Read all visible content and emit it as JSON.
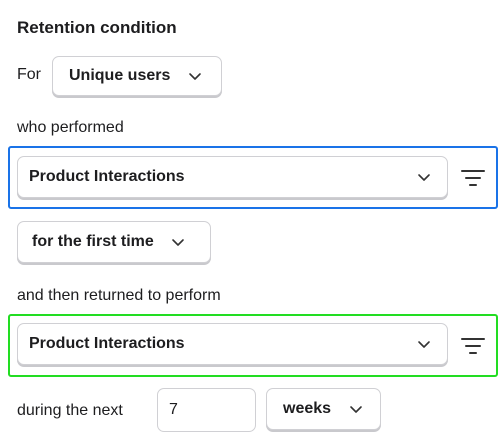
{
  "heading": "Retention condition",
  "for_label": "For",
  "user_type": {
    "selected": "Unique users",
    "icon": "chevron-down-icon"
  },
  "who_performed_label": "who performed",
  "first_event": {
    "selected": "Product Interactions",
    "icon": "chevron-down-icon",
    "filter_icon": "filter-icon",
    "highlight_color": "#1a73e8"
  },
  "occurrence": {
    "selected": "for the first time",
    "icon": "chevron-down-icon"
  },
  "returned_label": "and then returned to perform",
  "return_event": {
    "selected": "Product Interactions",
    "icon": "chevron-down-icon",
    "filter_icon": "filter-icon",
    "highlight_color": "#22dd22"
  },
  "during_label": "during the next",
  "period": {
    "value": "7",
    "unit": "weeks",
    "icon": "chevron-down-icon"
  }
}
